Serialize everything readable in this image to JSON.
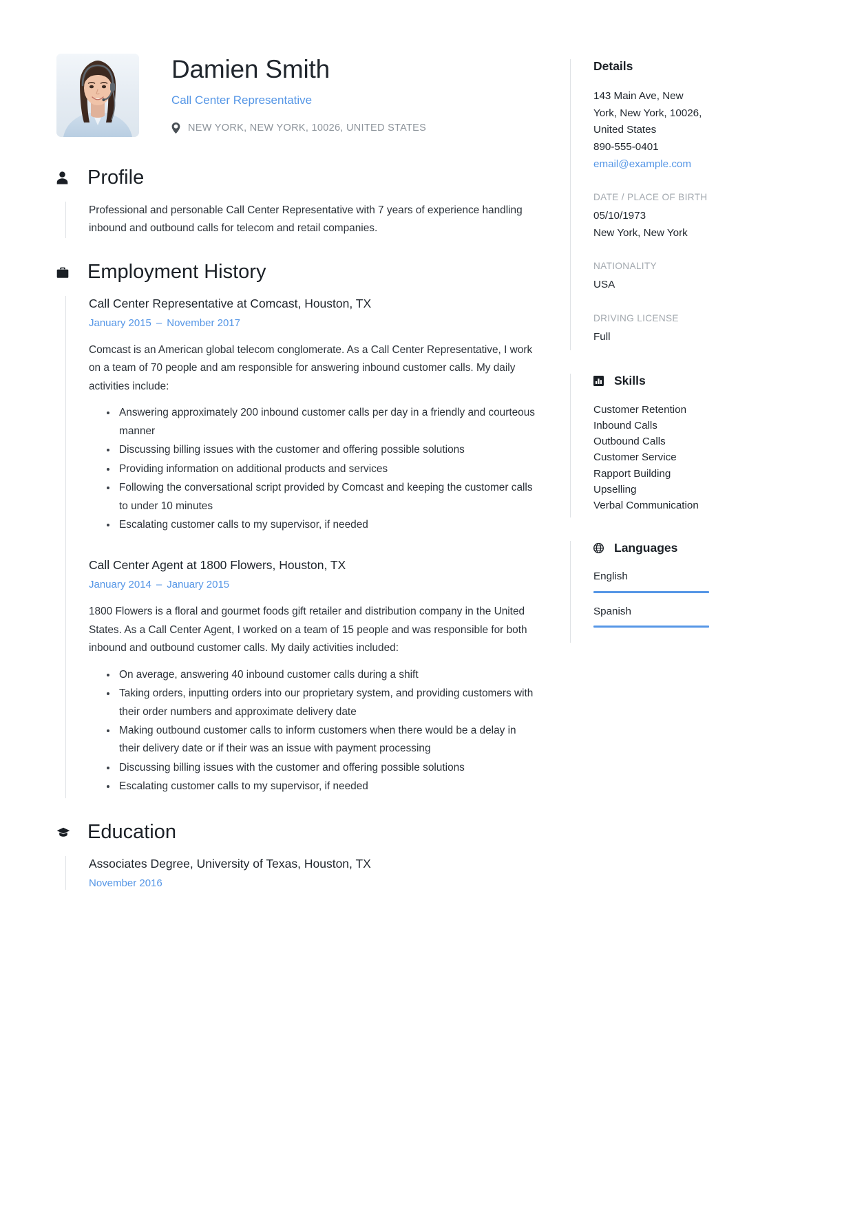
{
  "header": {
    "full_name": "Damien Smith",
    "job_title": "Call Center Representative",
    "location": "NEW YORK, NEW YORK, 10026, UNITED STATES",
    "location_icon": "map-pin-icon",
    "photo_alt": "profile-photo"
  },
  "profile": {
    "icon": "person-icon",
    "title": "Profile",
    "text": "Professional and personable Call Center Representative with 7 years of experience handling inbound and outbound calls for telecom and retail companies."
  },
  "employment": {
    "icon": "briefcase-icon",
    "title": "Employment History",
    "jobs": [
      {
        "heading": "Call Center Representative at Comcast, Houston, TX",
        "date_start": "January 2015",
        "date_dash": "–",
        "date_end": "November 2017",
        "description": "Comcast is an American global telecom conglomerate. As a Call Center Representative, I work on a team of 70 people and am responsible for answering inbound customer calls. My daily activities include:",
        "bullets": [
          "Answering approximately 200 inbound customer calls per day in a friendly and courteous manner",
          "Discussing billing issues with the customer and offering possible solutions",
          "Providing information on additional products and services",
          "Following the conversational script provided by Comcast and keeping the customer calls to under 10 minutes",
          "Escalating customer calls to my supervisor, if needed"
        ]
      },
      {
        "heading": "Call Center Agent at 1800 Flowers, Houston, TX",
        "date_start": "January 2014",
        "date_dash": "–",
        "date_end": "January 2015",
        "description": "1800 Flowers is a floral and gourmet foods gift retailer and distribution company in the United States. As a Call Center Agent, I worked on a team of 15 people and was responsible for both inbound and outbound customer calls. My daily activities included:",
        "bullets": [
          "On average, answering 40 inbound customer calls during a shift",
          "Taking orders, inputting orders into our proprietary system, and providing customers with their order numbers and approximate delivery date",
          "Making outbound customer calls to inform customers when there would be a delay in their delivery date or if their was an issue with payment processing",
          "Discussing billing issues with the customer and offering possible solutions",
          "Escalating customer calls to my supervisor, if needed"
        ]
      }
    ]
  },
  "education": {
    "icon": "graduation-cap-icon",
    "title": "Education",
    "entries": [
      {
        "heading": "Associates Degree, University of Texas, Houston, TX",
        "date": "November 2016"
      }
    ]
  },
  "details": {
    "title": "Details",
    "address_line1": "143 Main Ave, New",
    "address_line2": "York, New York, 10026,",
    "address_line3": "United States",
    "phone": "890-555-0401",
    "email": "email@example.com",
    "dob_label": "DATE / PLACE OF BIRTH",
    "dob_date": "05/10/1973",
    "dob_place": "New York, New York",
    "nationality_label": "NATIONALITY",
    "nationality_value": "USA",
    "license_label": "DRIVING LICENSE",
    "license_value": "Full"
  },
  "skills": {
    "icon": "bar-chart-icon",
    "title": "Skills",
    "items": [
      "Customer Retention",
      "Inbound Calls",
      "Outbound Calls",
      "Customer Service",
      "Rapport Building",
      "Upselling",
      "Verbal Communication"
    ]
  },
  "languages": {
    "icon": "globe-icon",
    "title": "Languages",
    "items": [
      {
        "name": "English",
        "level": 100
      },
      {
        "name": "Spanish",
        "level": 100
      }
    ]
  },
  "colors": {
    "accent": "#5596e6",
    "text": "#20262d",
    "muted": "#a3a9af",
    "rule": "#dfe2e5"
  }
}
